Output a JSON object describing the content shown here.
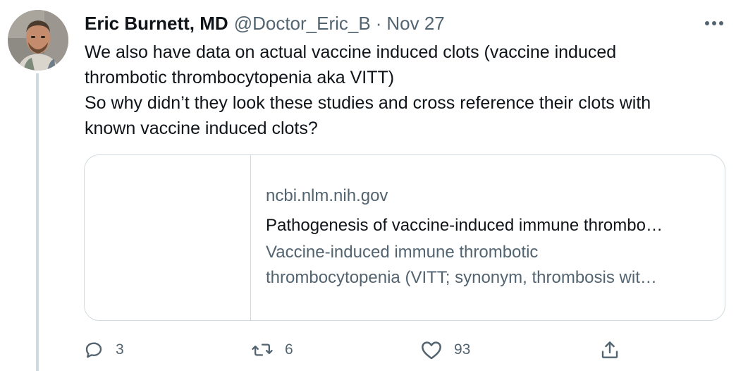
{
  "author": {
    "display_name": "Eric Burnett, MD",
    "handle": "@Doctor_Eric_B",
    "separator": "·",
    "date": "Nov 27"
  },
  "tweet": {
    "lines": [
      "We also have data on actual vaccine induced clots (vaccine induced",
      "thrombotic thrombocytopenia aka VITT)",
      "So why didn’t they look these studies and cross reference their clots with",
      "known vaccine induced clots?"
    ]
  },
  "link_card": {
    "domain": "ncbi.nlm.nih.gov",
    "title": "Pathogenesis of vaccine-induced immune thrombo…",
    "description_lines": [
      "Vaccine-induced immune thrombotic",
      "thrombocytopenia (VITT; synonym, thrombosis wit…"
    ]
  },
  "actions": {
    "reply_count": "3",
    "retweet_count": "6",
    "like_count": "93",
    "reply_icon": "reply-icon",
    "retweet_icon": "retweet-icon",
    "like_icon": "heart-icon",
    "share_icon": "share-icon",
    "more_icon": "more-icon"
  },
  "colors": {
    "text_primary": "#0f1419",
    "text_secondary": "#536471",
    "border": "#cfd9de"
  }
}
